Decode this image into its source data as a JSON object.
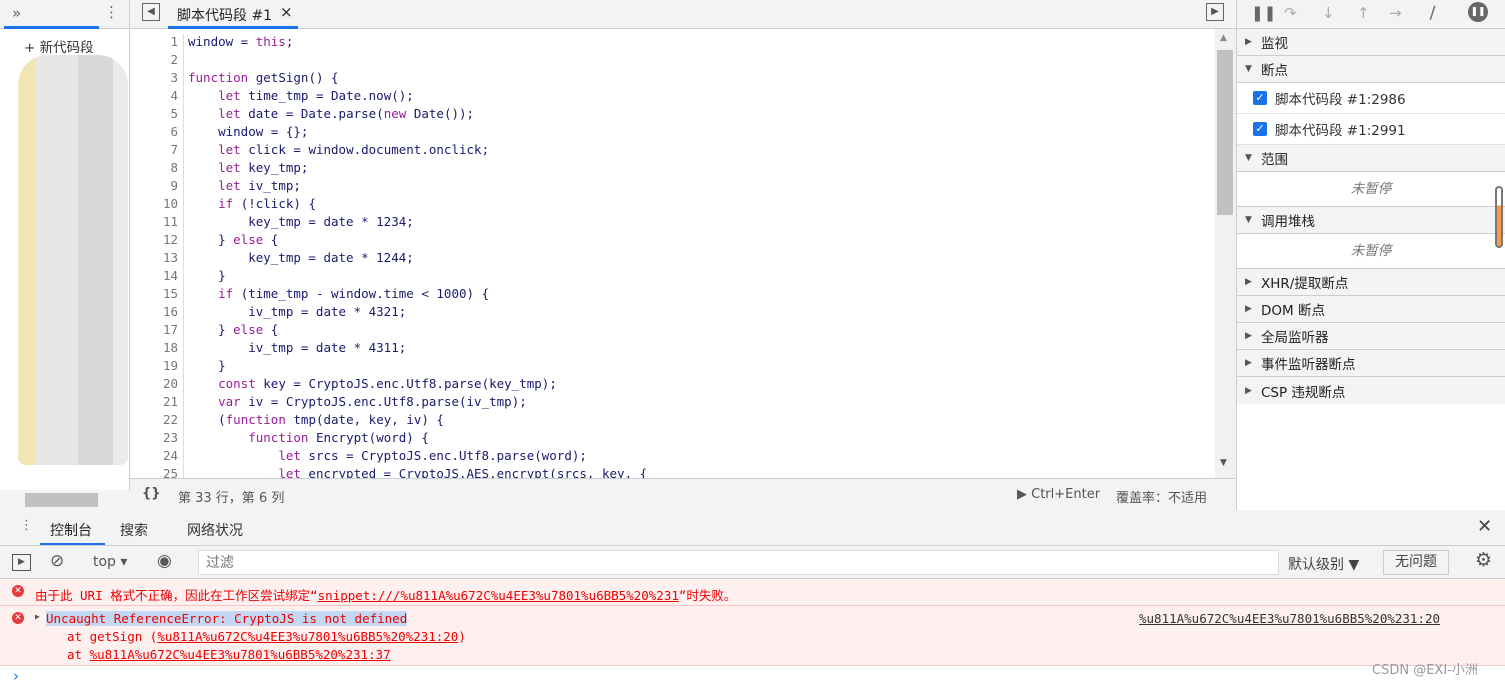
{
  "left": {
    "new_snippet": "+ 新代码段"
  },
  "editor": {
    "tab": "脚本代码段 #1",
    "close": "×",
    "lines": [
      "window = this;",
      "",
      "function getSign() {",
      "    let time_tmp = Date.now();",
      "    let date = Date.parse(new Date());",
      "    window = {};",
      "    let click = window.document.onclick;",
      "    let key_tmp;",
      "    let iv_tmp;",
      "    if (!click) {",
      "        key_tmp = date * 1234;",
      "    } else {",
      "        key_tmp = date * 1244;",
      "    }",
      "    if (time_tmp - window.time < 1000) {",
      "        iv_tmp = date * 4321;",
      "    } else {",
      "        iv_tmp = date * 4311;",
      "    }",
      "    const key = CryptoJS.enc.Utf8.parse(key_tmp);",
      "    var iv = CryptoJS.enc.Utf8.parse(iv_tmp);",
      "    (function tmp(date, key, iv) {",
      "        function Encrypt(word) {",
      "            let srcs = CryptoJS.enc.Utf8.parse(word);",
      "            let encrypted = CryptoJS.AES.encrypt(srcs, key, {"
    ],
    "status": {
      "braces": "{}",
      "position": "第 33 行，第 6 列",
      "run": "▶ Ctrl+Enter",
      "coverage": "覆盖率：不适用"
    }
  },
  "debugger": {
    "sections": {
      "watch": "监视",
      "breakpoints": "断点",
      "scope": "范围",
      "callstack": "调用堆栈",
      "xhr": "XHR/提取断点",
      "dom": "DOM 断点",
      "global": "全局监听器",
      "event": "事件监听器断点",
      "csp": "CSP 违规断点"
    },
    "breakpoints": [
      "脚本代码段 #1:2986",
      "脚本代码段 #1:2991"
    ],
    "not_paused": "未暂停"
  },
  "drawer": {
    "tabs": [
      "控制台",
      "搜索",
      "网络状况"
    ],
    "context": "top",
    "filter_placeholder": "过滤",
    "level": "默认级别 ▼",
    "issues": "无问题"
  },
  "console": {
    "msg1_text": "由于此 URI 格式不正确，因此在工作区尝试绑定“",
    "msg1_link": "snippet:///%u811A%u672C%u4EE3%u7801%u6BB5%20%231",
    "msg1_tail": "”时失败。",
    "msg2_title": "Uncaught ReferenceError: CryptoJS is not defined",
    "msg2_source": "%u811A%u672C%u4EE3%u7801%u6BB5%20%231:20",
    "stack1_pre": "at getSign (",
    "stack1_link": "%u811A%u672C%u4EE3%u7801%u6BB5%20%231:20",
    "stack1_post": ")",
    "stack2_pre": "at ",
    "stack2_link": "%u811A%u672C%u4EE3%u7801%u6BB5%20%231:37",
    "prompt": "›"
  },
  "watermark": "CSDN @EXI-小洲",
  "colors": {
    "accent": "#1a73e8",
    "error": "#e00000",
    "error_bg": "#fff0f0"
  }
}
